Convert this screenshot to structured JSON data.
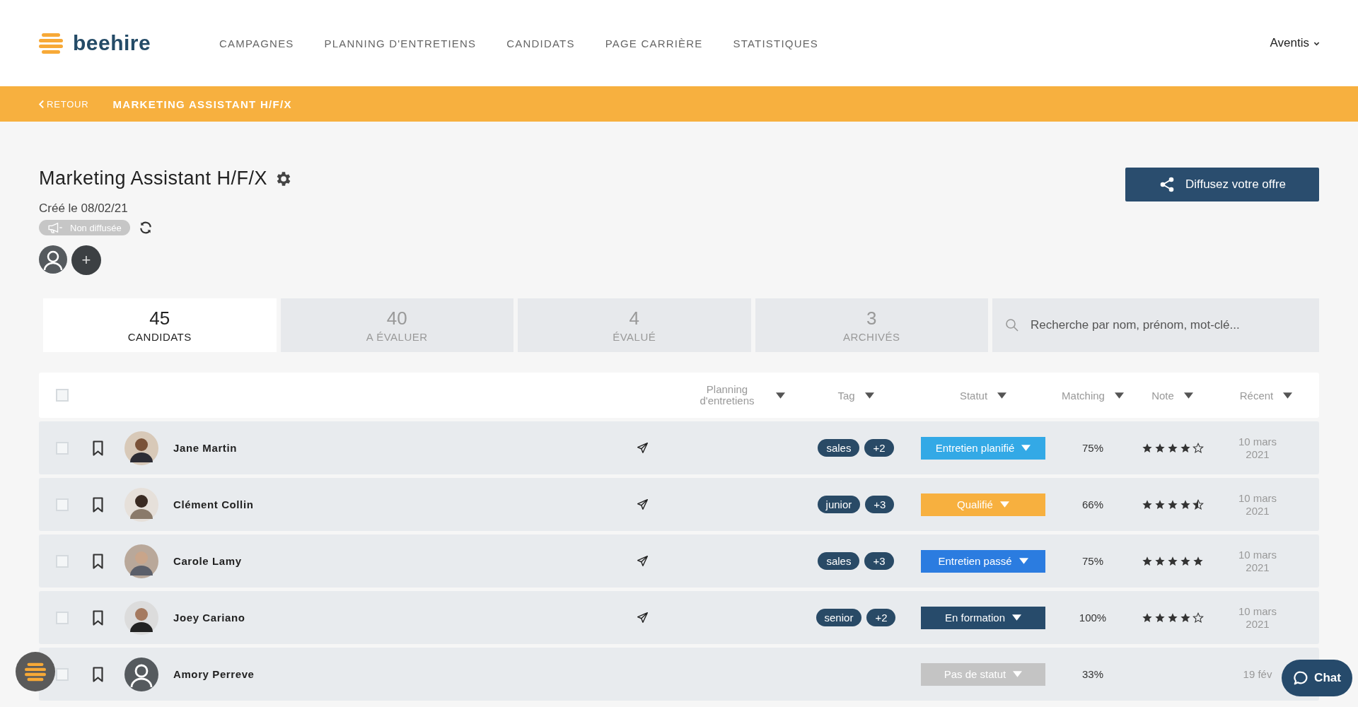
{
  "brand": {
    "name": "beehire"
  },
  "nav": [
    {
      "label": "CAMPAGNES"
    },
    {
      "label": "PLANNING D'ENTRETIENS"
    },
    {
      "label": "CANDIDATS"
    },
    {
      "label": "PAGE CARRIÈRE"
    },
    {
      "label": "STATISTIQUES"
    }
  ],
  "account": {
    "label": "Aventis"
  },
  "breadcrumb": {
    "back": "RETOUR",
    "title": "MARKETING ASSISTANT H/F/X"
  },
  "job": {
    "title": "Marketing Assistant H/F/X",
    "created": "Créé le 08/02/21",
    "status": "Non diffusée",
    "share_button": "Diffusez votre offre",
    "add_member": "+"
  },
  "tabs": [
    {
      "count": "45",
      "label": "CANDIDATS",
      "selected": true
    },
    {
      "count": "40",
      "label": "A ÉVALUER",
      "selected": false
    },
    {
      "count": "4",
      "label": "ÉVALUÉ",
      "selected": false
    },
    {
      "count": "3",
      "label": "ARCHIVÉS",
      "selected": false
    }
  ],
  "search": {
    "placeholder": "Recherche par nom, prénom, mot-clé..."
  },
  "table": {
    "select_all": {
      "checked": false
    },
    "columns": [
      {
        "label": "Planning d'entretiens"
      },
      {
        "label": "Tag"
      },
      {
        "label": "Statut"
      },
      {
        "label": "Matching"
      },
      {
        "label": "Note"
      },
      {
        "label": "Récent"
      }
    ],
    "rows": [
      {
        "checked": false,
        "name": "Jane Martin",
        "kind": "photo",
        "invited": true,
        "tags": [
          "sales",
          "+2"
        ],
        "status": "Entretien planifié",
        "color": "#33a9e6",
        "matching": "75%",
        "stars": 4,
        "recent": [
          "10 mars",
          "2021"
        ]
      },
      {
        "checked": false,
        "name": "Clément Collin",
        "kind": "photo",
        "invited": true,
        "tags": [
          "junior",
          "+3"
        ],
        "status": "Qualifié",
        "color": "#f7b03f",
        "matching": "66%",
        "stars": 4.5,
        "recent": [
          "10 mars",
          "2021"
        ]
      },
      {
        "checked": false,
        "name": "Carole Lamy",
        "kind": "photo",
        "invited": true,
        "tags": [
          "sales",
          "+3"
        ],
        "status": "Entretien passé",
        "color": "#2b7ce0",
        "matching": "75%",
        "stars": 5,
        "recent": [
          "10 mars",
          "2021"
        ]
      },
      {
        "checked": false,
        "name": "Joey Cariano",
        "kind": "photo",
        "invited": true,
        "tags": [
          "senior",
          "+2"
        ],
        "status": "En formation",
        "color": "#274b6b",
        "matching": "100%",
        "stars": 4,
        "recent": [
          "10 mars",
          "2021"
        ]
      },
      {
        "checked": false,
        "name": "Amory Perreve",
        "kind": "default",
        "invited": false,
        "tags": [],
        "status": "Pas de statut",
        "color": "#c4c4c4",
        "matching": "33%",
        "recent": [
          "19 fév"
        ]
      }
    ]
  },
  "chat": {
    "label": "Chat"
  }
}
